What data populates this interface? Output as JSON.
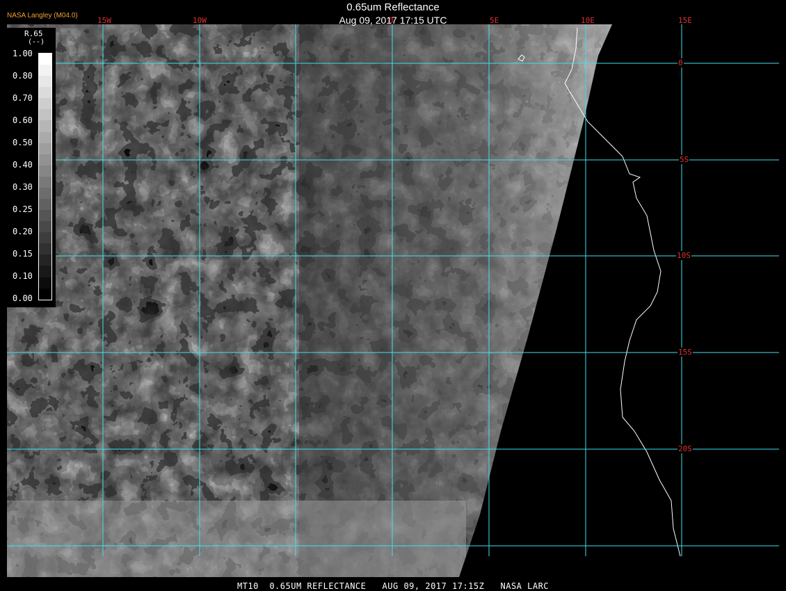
{
  "title": "0.65um Reflectance",
  "datetime": "Aug 09, 2017 17:15 UTC",
  "credit": "NASA Langley (M04.0)",
  "footer": "MT10  0.65UM REFLECTANCE   AUG 09, 2017 17:15Z   NASA LARC",
  "legend": {
    "title": "R.65",
    "unit": "(--)",
    "ticks": [
      "1.00",
      "0.80",
      "0.70",
      "0.60",
      "0.50",
      "0.40",
      "0.30",
      "0.25",
      "0.20",
      "0.15",
      "0.10",
      "0.00"
    ]
  },
  "longitude_labels": [
    "15W",
    "10W",
    "0",
    "5E",
    "10E",
    "15E"
  ],
  "latitude_labels": [
    "0",
    "5S",
    "10S",
    "15S",
    "20S"
  ],
  "colors": {
    "grid": "#40e0f0",
    "coastline": "#ffffff",
    "label": "#e03030",
    "credit": "#f0a030"
  }
}
